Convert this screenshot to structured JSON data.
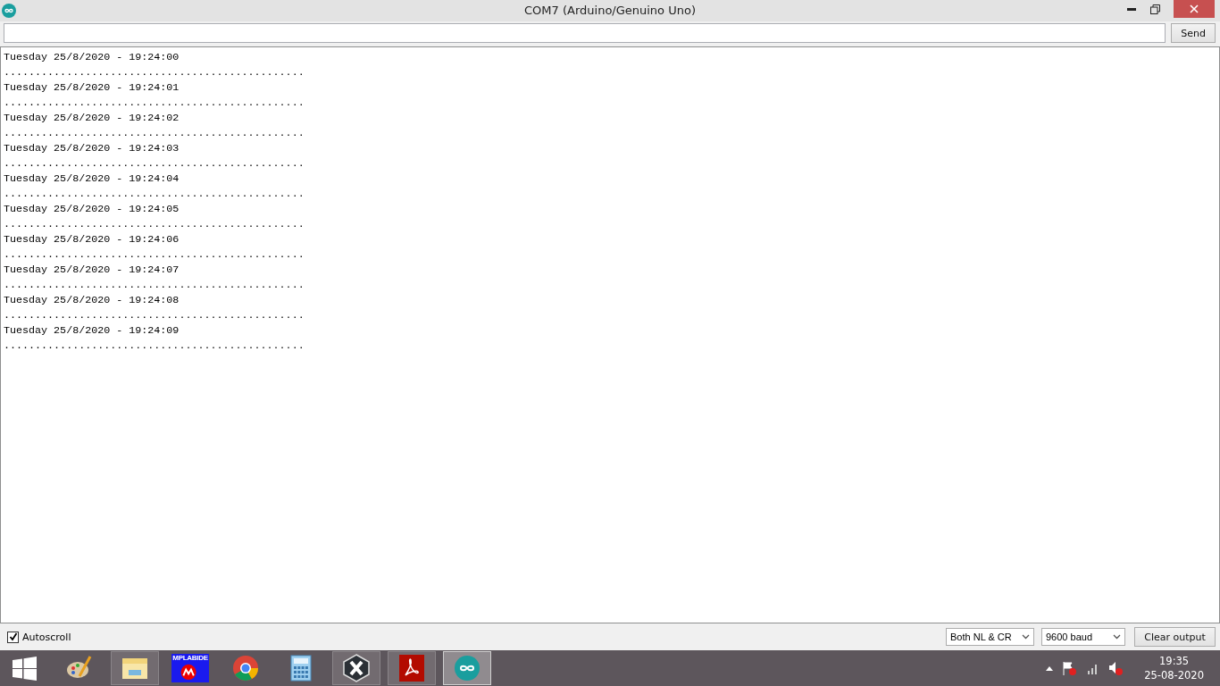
{
  "window": {
    "title": "COM7 (Arduino/Genuino Uno)"
  },
  "send_button": "Send",
  "output_lines": [
    "Tuesday 25/8/2020 - 19:24:00",
    "................................................",
    "Tuesday 25/8/2020 - 19:24:01",
    "................................................",
    "Tuesday 25/8/2020 - 19:24:02",
    "................................................",
    "Tuesday 25/8/2020 - 19:24:03",
    "................................................",
    "Tuesday 25/8/2020 - 19:24:04",
    "................................................",
    "Tuesday 25/8/2020 - 19:24:05",
    "................................................",
    "Tuesday 25/8/2020 - 19:24:06",
    "................................................",
    "Tuesday 25/8/2020 - 19:24:07",
    "................................................",
    "Tuesday 25/8/2020 - 19:24:08",
    "................................................",
    "Tuesday 25/8/2020 - 19:24:09",
    "................................................"
  ],
  "autoscroll": {
    "label": "Autoscroll",
    "checked": true
  },
  "line_ending": "Both NL & CR",
  "baud_rate": "9600 baud",
  "clear_button": "Clear output",
  "taskbar": {
    "apps": [
      {
        "kind": "paint",
        "running": false,
        "selected": false
      },
      {
        "kind": "explorer",
        "running": true,
        "selected": false
      },
      {
        "kind": "mplab",
        "label": "MPLABIDE",
        "running": false,
        "selected": false
      },
      {
        "kind": "chrome",
        "running": false,
        "selected": false
      },
      {
        "kind": "calculator",
        "running": false,
        "selected": false
      },
      {
        "kind": "xapp",
        "running": true,
        "selected": false
      },
      {
        "kind": "acrobat",
        "running": true,
        "selected": false
      },
      {
        "kind": "arduino",
        "running": true,
        "selected": true
      }
    ],
    "time": "19:35",
    "date": "25-08-2020"
  }
}
